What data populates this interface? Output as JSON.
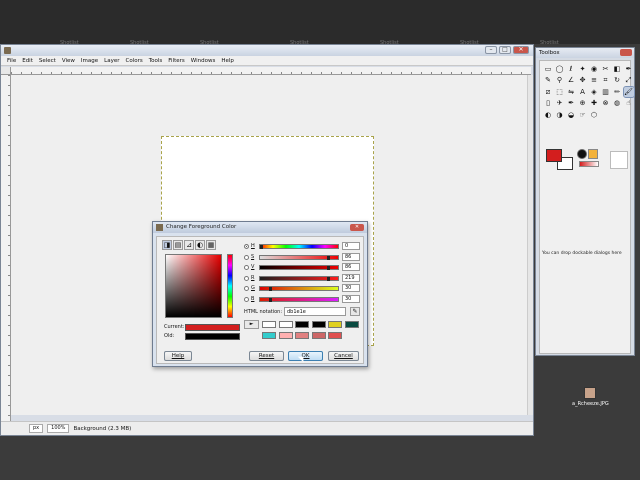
{
  "top_strip": {
    "ghost_labels": [
      "Shotlist",
      "Shotlist",
      "Shotlist",
      "Shotlist",
      "Shotlist",
      "Shotlist",
      "Shotlist"
    ]
  },
  "main_window": {
    "title": "",
    "menu": [
      "File",
      "Edit",
      "Select",
      "View",
      "Image",
      "Layer",
      "Colors",
      "Tools",
      "Filters",
      "Windows",
      "Help"
    ],
    "status": {
      "unit": "px",
      "zoom": "100%",
      "text": "Background (2.3 MB)"
    }
  },
  "toolbox": {
    "title": "Toolbox",
    "dock_hint": "You can drop dockable dialogs here",
    "tool_icons": [
      "rect-select-icon",
      "ellipse-select-icon",
      "lasso-icon",
      "fuzzy-select-icon",
      "color-select-icon",
      "scissors-icon",
      "foreground-select-icon",
      "paths-icon",
      "color-picker-icon",
      "zoom-icon",
      "measure-icon",
      "move-icon",
      "align-icon",
      "crop-icon",
      "rotate-icon",
      "scale-icon",
      "shear-icon",
      "perspective-icon",
      "flip-icon",
      "text-icon",
      "bucket-fill-icon",
      "blend-icon",
      "pencil-icon",
      "paintbrush-icon",
      "eraser-icon",
      "airbrush-icon",
      "ink-icon",
      "clone-icon",
      "heal-icon",
      "perspective-clone-icon",
      "blur-icon",
      "smudge-icon",
      "dodge-icon",
      "burn-icon",
      "dodge-burn-icon",
      "smudge2-icon",
      "cage-icon"
    ],
    "fg_color": "#d31e1e",
    "bg_color": "#ffffff"
  },
  "desktop_icon": {
    "label": "a_Rcheeze.JPG"
  },
  "dialog": {
    "title": "Change Foreground Color",
    "channels": [
      {
        "label": "H",
        "value": "0",
        "fraction": 0.0,
        "selected": true
      },
      {
        "label": "S",
        "value": "86",
        "fraction": 0.86,
        "selected": false
      },
      {
        "label": "V",
        "value": "86",
        "fraction": 0.86,
        "selected": false
      },
      {
        "label": "R",
        "value": "219",
        "fraction": 0.86,
        "selected": false
      },
      {
        "label": "G",
        "value": "30",
        "fraction": 0.12,
        "selected": false
      },
      {
        "label": "B",
        "value": "30",
        "fraction": 0.12,
        "selected": false
      }
    ],
    "html_notation_label": "HTML notation:",
    "html_value": "db1e1e",
    "current_label": "Current:",
    "old_label": "Old:",
    "current_color": "#d31e1e",
    "old_color": "#000000",
    "history_colors": [
      "#ffffff",
      "#ffffff",
      "#000000",
      "#000000",
      "#e0d020",
      "#0a4a40",
      "#33cccc",
      "#ffb0b0",
      "#e08080",
      "#cc6666",
      "#e05050"
    ],
    "buttons": {
      "help": "Help",
      "reset": "Reset",
      "ok": "OK",
      "cancel": "Cancel"
    }
  }
}
